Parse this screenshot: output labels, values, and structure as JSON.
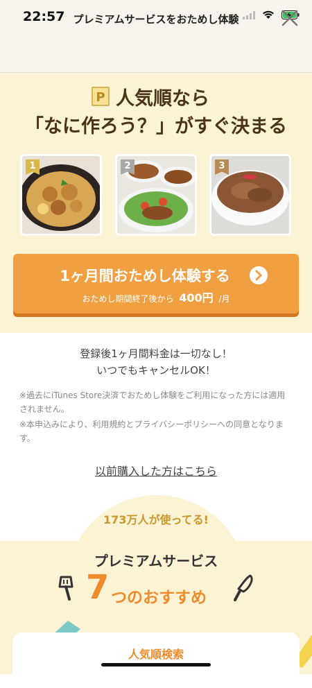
{
  "status_bar": {
    "time": "22:57"
  },
  "header": {
    "title": "プレミアムサービスをおためし体験",
    "close_icon": "close-icon"
  },
  "hero": {
    "badge": "P",
    "line1": "人気順なら",
    "line2": "「なに作ろう？」がすぐ決まる",
    "photos": [
      {
        "rank": "1",
        "rank_color": "#d9b84a"
      },
      {
        "rank": "2",
        "rank_color": "#a8a8a8"
      },
      {
        "rank": "3",
        "rank_color": "#b98a55"
      }
    ]
  },
  "cta": {
    "label": "1ヶ月間おためし体験する",
    "sub_prefix": "おためし期間終了後から",
    "price": "400円",
    "per": "/月",
    "color": "#f0a040"
  },
  "info": {
    "free_line1": "登録後1ヶ月間料金は一切なし！",
    "free_line2": "いつでもキャンセルOK！",
    "note1": "※過去にiTunes Store決済でおためし体験をご利用になった方には適用されません。",
    "note2_prefix": "※本申込みにより、",
    "terms_link": "利用規約",
    "and": "と",
    "privacy_link": "プライバシーポリシー",
    "note2_suffix": "への同意となります。",
    "previous_purchase_link": "以前購入した方はこちら"
  },
  "features": {
    "users": "173万人が使ってる!",
    "premium": "プレミアムサービス",
    "seven": "7",
    "recommend": "つのおすすめ",
    "first_card_title": "人気順検索"
  }
}
